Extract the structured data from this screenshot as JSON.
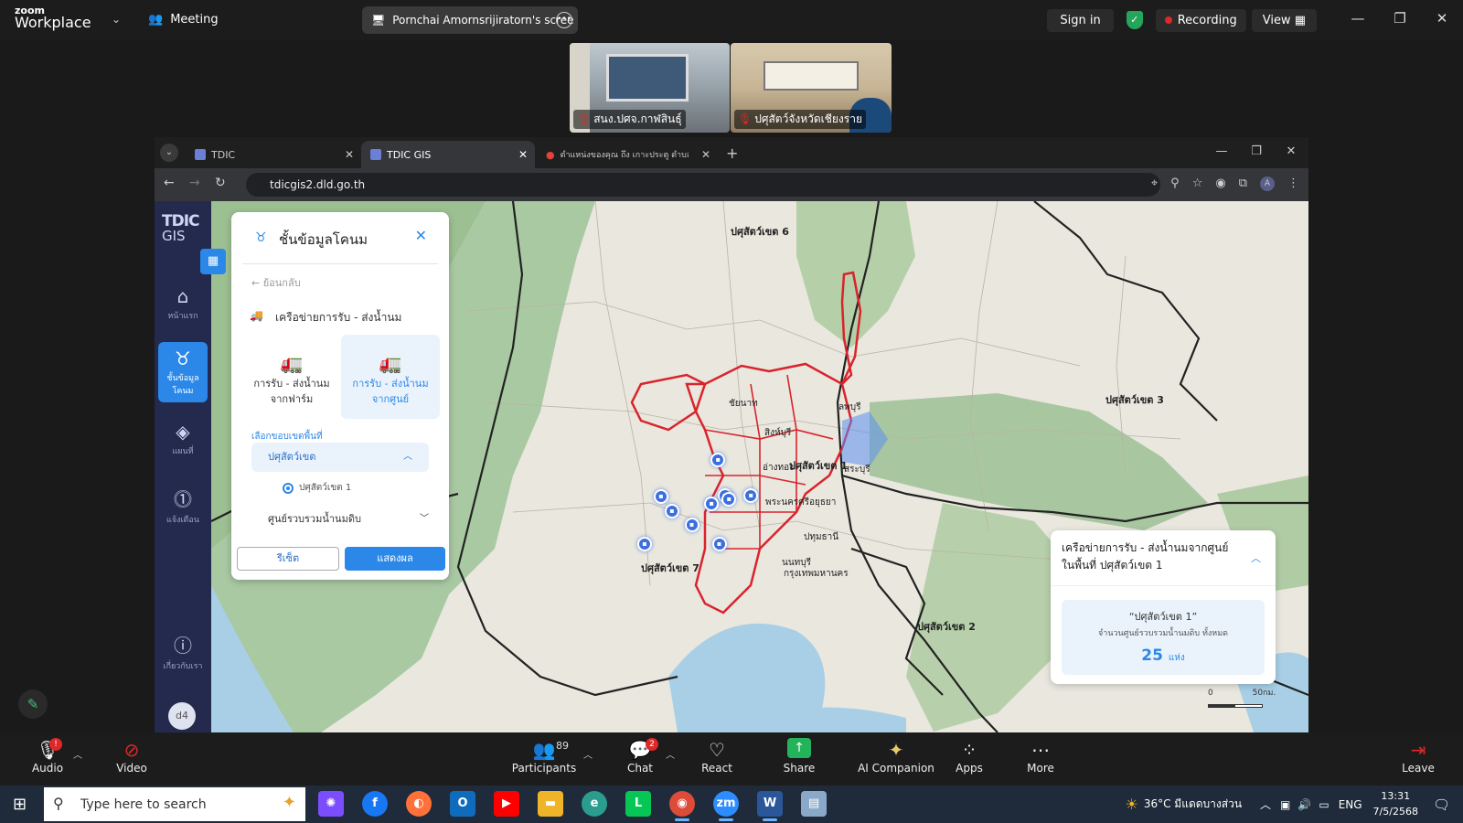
{
  "zoom_top": {
    "logo_line1": "zoom",
    "logo_line2": "Workplace",
    "meeting_label": "Meeting",
    "share_title": "Pornchai Amornsrijiratorn's scree",
    "sign_in": "Sign in",
    "recording": "Recording",
    "view": "View"
  },
  "thumbnails": [
    {
      "label": "สนง.ปศจ.กาฬสินธุ์"
    },
    {
      "label": "ปศุสัตว์จังหวัดเชียงราย"
    }
  ],
  "browser": {
    "tabs": [
      {
        "title": "TDIC"
      },
      {
        "title": "TDIC GIS"
      },
      {
        "title": "ตำแหน่งของคุณ ถึง เกาะประตู ตำบล"
      }
    ],
    "url": "tdicgis2.dld.go.th"
  },
  "app": {
    "logo_top": "TDIC",
    "logo_bottom": "GIS",
    "nav": [
      {
        "label": "หน้าแรก",
        "icon": "home-icon"
      },
      {
        "label": "ชั้นข้อมูลโคนม",
        "icon": "cow-icon"
      },
      {
        "label": "แผนที่",
        "icon": "layers-icon"
      },
      {
        "label": "แจ้งเตือน",
        "icon": "alert-icon"
      },
      {
        "label": "เกี่ยวกับเรา",
        "icon": "info-icon"
      }
    ],
    "user_avatar": "d4"
  },
  "panel": {
    "title": "ชั้นข้อมูลโคนม",
    "back": "ย้อนกลับ",
    "subtitle": "เครือข่ายการรับ - ส่งน้ำนม",
    "option1_line1": "การรับ - ส่งน้ำนม",
    "option1_line2": "จากฟาร์ม",
    "option2_line1": "การรับ - ส่งน้ำนม",
    "option2_line2": "จากศูนย์",
    "select_label": "เลือกขอบเขตพื้นที่",
    "accordion": "ปศุสัตว์เขต",
    "radio_option": "ปศุสัตว์เขต 1",
    "center_dropdown": "ศูนย์รวบรวมน้ำนมดิบ",
    "reset": "รีเซ็ต",
    "show": "แสดงผล"
  },
  "map": {
    "labels": [
      "ปศุสัตว์เขต 6",
      "ปศุสัตว์เขต 3",
      "ปศุสัตว์เขต 1",
      "ปศุสัตว์เขต 7",
      "ปศุสัตว์เขต 2",
      "ลพบุรี",
      "ชัยนาท",
      "สิงห์บุรี",
      "อ่างทอง",
      "สระบุรี",
      "พระนครศรีอยุธยา",
      "ปทุมธานี",
      "นนทบุรี",
      "กรุงเทพมหานคร"
    ],
    "markers": [
      [
        0.462,
        0.178
      ],
      [
        0.41,
        0.246
      ],
      [
        0.468,
        0.244
      ],
      [
        0.492,
        0.245
      ],
      [
        0.42,
        0.273
      ],
      [
        0.456,
        0.26
      ],
      [
        0.438,
        0.3
      ],
      [
        0.395,
        0.335
      ],
      [
        0.463,
        0.335
      ],
      [
        0.472,
        0.251
      ]
    ],
    "info_title": "เครือข่ายการรับ - ส่งน้ำนมจากศูนย์ ในพื้นที่ ปศุสัตว์เขต 1",
    "info_region": "“ปศุสัตว์เขต 1”",
    "info_desc": "จำนวนศูนย์รวบรวมน้ำนมดิบ ทั้งหมด",
    "info_count": "25",
    "info_unit": "แห่ง",
    "scale_0": "0",
    "scale_50": "50กม."
  },
  "zoom_bottom": {
    "audio": "Audio",
    "video": "Video",
    "participants": "Participants",
    "participants_count": "89",
    "chat": "Chat",
    "chat_badge": "2",
    "react": "React",
    "share": "Share",
    "ai_companion": "AI Companion",
    "apps": "Apps",
    "more": "More",
    "leave": "Leave"
  },
  "taskbar": {
    "search_placeholder": "Type here to search",
    "weather": "36°C มีแดดบางส่วน",
    "lang": "ENG",
    "time": "13:31",
    "date": "7/5/2568"
  },
  "colors": {
    "accent": "#2b88e8",
    "region_outline": "#d9232d",
    "recording_dot": "#e02828"
  }
}
